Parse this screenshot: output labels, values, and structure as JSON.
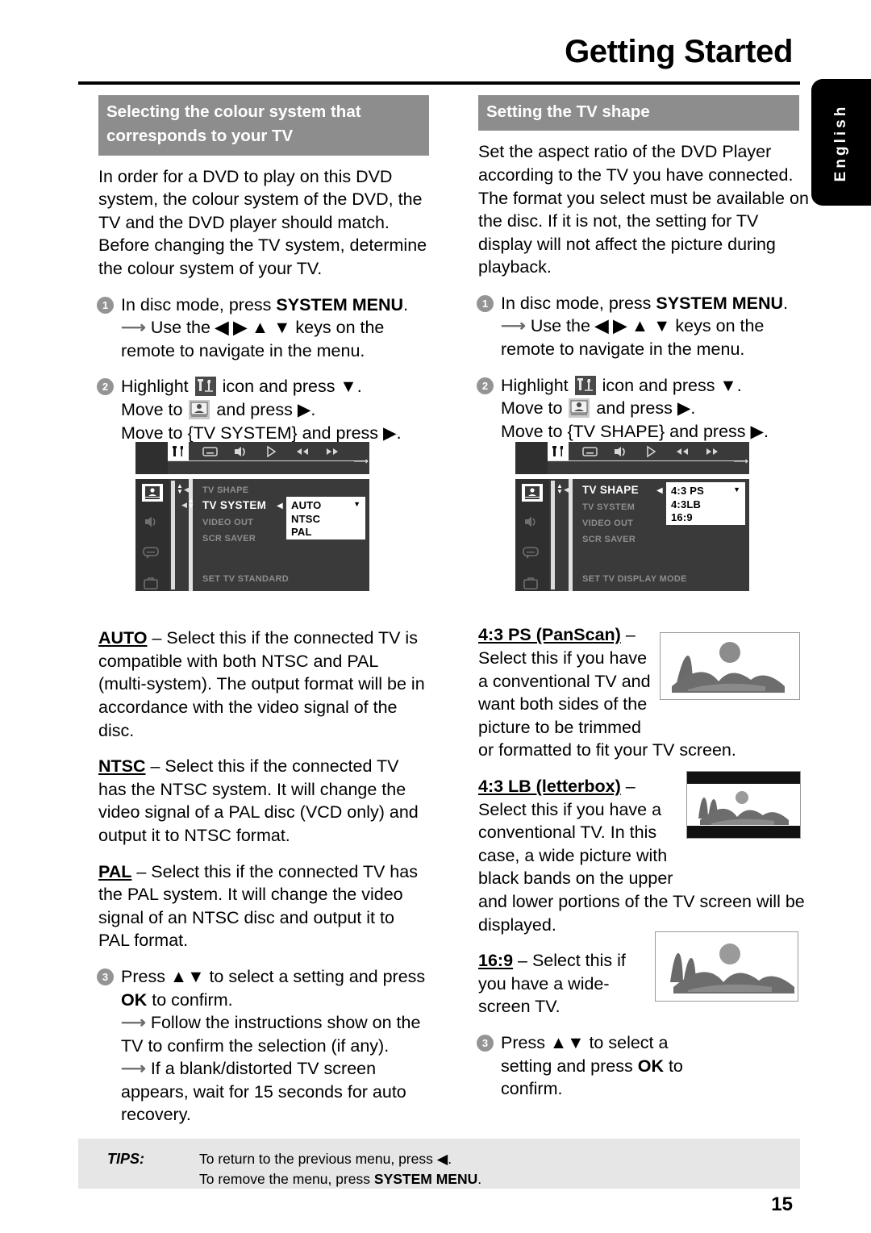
{
  "page": {
    "title": "Getting Started",
    "number": "15",
    "language_tab": "English"
  },
  "left_column": {
    "heading": "Selecting the colour system that corresponds to your TV",
    "intro": "In order for a DVD to play on this DVD system, the colour system of the DVD, the TV and the DVD player should match. Before changing the TV system, determine the colour system of your TV.",
    "steps": [
      {
        "num": "1",
        "text_before": "In disc mode, press ",
        "bold": "SYSTEM MENU",
        "text_after": ".",
        "sub1_prefix": "Use the ",
        "sub1_keys": "◀ ▶ ▲ ▼",
        "sub1_suffix": " keys on the remote to navigate in the menu."
      },
      {
        "num": "2",
        "line1_before": "Highlight ",
        "line1_after": " icon and press ▼.",
        "line2_before": "Move to ",
        "line2_after": " and press ▶.",
        "line3": "Move to {TV SYSTEM} and press ▶."
      },
      {
        "num": "3",
        "text_before": "Press ▲▼ to select a setting and press ",
        "bold": "OK",
        "text_after": " to confirm.",
        "sub1": "Follow the instructions show on the TV to confirm the selection (if any).",
        "sub2": "If a blank/distorted TV screen appears, wait for 15 seconds for auto recovery."
      }
    ],
    "options": [
      {
        "term": "AUTO",
        "body": " – Select this if the connected TV is compatible with both NTSC and PAL (multi-system). The output format will be in accordance with the video signal of the disc."
      },
      {
        "term": "NTSC",
        "body": " – Select this if the connected TV has the NTSC system. It will change the video signal of a PAL disc (VCD only) and output it to NTSC format."
      },
      {
        "term": "PAL",
        "body": " – Select this if the connected TV has the PAL system. It will change the video signal of an NTSC disc and output it to PAL format."
      }
    ],
    "osd": {
      "menu_items": [
        "TV SHAPE",
        "TV SYSTEM",
        "VIDEO OUT",
        "SCR SAVER"
      ],
      "active_item": "TV SYSTEM",
      "footer": "SET TV STANDARD",
      "popup_options": [
        "AUTO",
        "NTSC",
        "PAL"
      ]
    }
  },
  "right_column": {
    "heading": "Setting the TV shape",
    "intro": "Set the aspect ratio of the DVD Player according to the TV you have connected. The format you select must be available on the disc.  If it is not, the setting for TV display will not affect the picture during playback.",
    "steps": [
      {
        "num": "1",
        "text_before": "In disc mode, press ",
        "bold": "SYSTEM MENU",
        "text_after": ".",
        "sub1_prefix": "Use the ",
        "sub1_keys": "◀ ▶ ▲ ▼",
        "sub1_suffix": " keys on the remote to navigate in the menu."
      },
      {
        "num": "2",
        "line1_before": "Highlight ",
        "line1_after": " icon and press ▼.",
        "line2_before": "Move to ",
        "line2_after": " and press ▶.",
        "line3": "Move to {TV SHAPE} and press ▶."
      },
      {
        "num": "3",
        "text_before": "Press ▲▼ to select a setting and press ",
        "bold": "OK",
        "text_after": " to confirm."
      }
    ],
    "options": [
      {
        "term": "4:3 PS (PanScan)",
        "body_narrow": " – Select this if you have a conventional TV and want both sides of the picture to be trimmed",
        "body_full": "or formatted to fit your TV screen."
      },
      {
        "term": "4:3 LB (letterbox)",
        "body_narrow": " – Select this if you have a conventional TV. In this case, a wide picture with black bands on the upper",
        "body_full": "and lower portions of the TV screen will be displayed."
      },
      {
        "term": "16:9",
        "body_narrow": "  – Select this if you have a wide-screen TV.",
        "body_full": ""
      }
    ],
    "osd": {
      "menu_items": [
        "TV SHAPE",
        "TV SYSTEM",
        "VIDEO OUT",
        "SCR SAVER"
      ],
      "active_item": "TV SHAPE",
      "footer": "SET TV DISPLAY MODE",
      "popup_options": [
        "4:3 PS",
        "4:3LB",
        "16:9"
      ]
    }
  },
  "tips": {
    "label": "TIPS:",
    "line1": "To return to the previous menu, press ◀.",
    "line2_before": "To remove the menu, press ",
    "line2_bold": "SYSTEM MENU",
    "line2_after": "."
  },
  "colors": {
    "heading_bar": "#8d8d8d",
    "tips_bg": "#e6e6e6",
    "osd_bg": "#3a3a3a",
    "step_bullet": "#949494"
  }
}
